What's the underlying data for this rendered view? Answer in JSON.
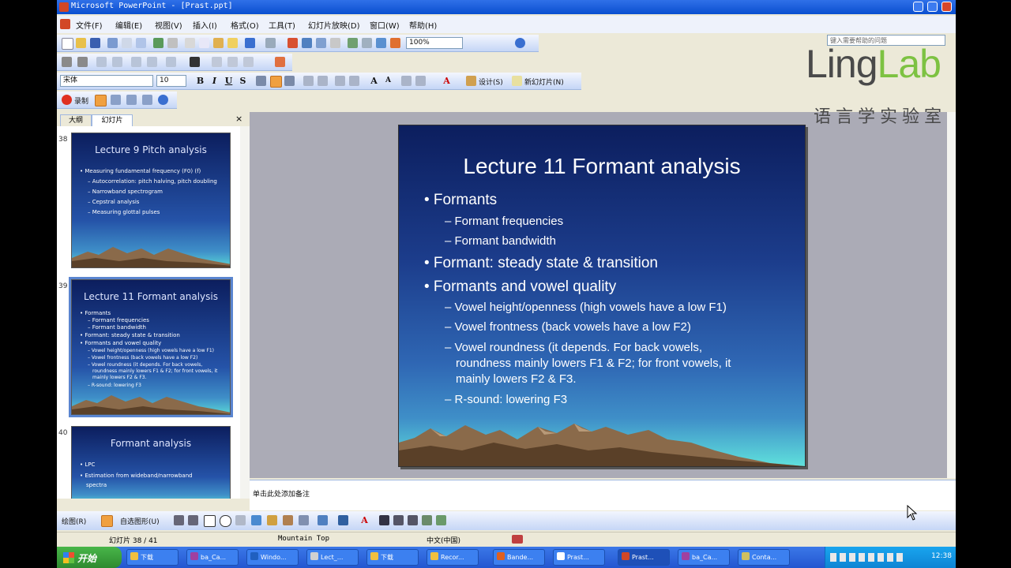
{
  "window": {
    "title": "Microsoft PowerPoint - [Prast.ppt]",
    "help_placeholder": "键入需要帮助的问题"
  },
  "menu": [
    "文件(F)",
    "编辑(E)",
    "视图(V)",
    "插入(I)",
    "格式(O)",
    "工具(T)",
    "幻灯片放映(D)",
    "窗口(W)",
    "帮助(H)"
  ],
  "toolbar": {
    "zoom": "100%",
    "font_name": "宋体",
    "font_size": "10",
    "bold": "B",
    "italic": "I",
    "underline": "U",
    "shadow": "S",
    "design_label": "设计(S)",
    "new_slide_label": "新幻灯片(N)",
    "record_label": "录制"
  },
  "pane_tabs": {
    "outline": "大纲",
    "slides": "幻灯片"
  },
  "thumbnails": [
    {
      "num": "38",
      "title": "Lecture 9 Pitch analysis",
      "lines": [
        "• Measuring fundamental frequency (F0) (f)",
        "– Autocorrelation: pitch halving, pitch doubling",
        "– Narrowband spectrogram",
        "– Cepstral analysis",
        "– Measuring glottal pulses"
      ]
    },
    {
      "num": "39",
      "title": "Lecture 11 Formant analysis",
      "lines": [
        "• Formants",
        "– Formant frequencies",
        "– Formant bandwidth",
        "• Formant: steady state & transition",
        "• Formants and vowel quality",
        "– Vowel height/openness (high vowels have a low F1)",
        "– Vowel frontness (back vowels have a low F2)",
        "– Vowel roundness (it depends. For back vowels,",
        "roundness mainly lowers F1 & F2; for front vowels, it",
        "mainly lowers F2 & F3.",
        "– R-sound: lowering F3"
      ]
    },
    {
      "num": "40",
      "title": "Formant analysis",
      "lines": [
        "• LPC",
        "• Estimation from wideband/narrowband",
        "spectra"
      ]
    }
  ],
  "slide": {
    "title": "Lecture 11 Formant analysis",
    "bullets": [
      "• Formants",
      "– Formant frequencies",
      "– Formant bandwidth",
      "• Formant: steady state & transition",
      "• Formants and vowel quality",
      "– Vowel height/openness (high vowels have a low F1)",
      "– Vowel frontness (back vowels have a low F2)",
      "– Vowel roundness (it depends. For back vowels,",
      "roundness mainly lowers F1 & F2; for front vowels, it",
      "mainly lowers F2 & F3.",
      "– R-sound: lowering F3"
    ]
  },
  "notes_placeholder": "单击此处添加备注",
  "drawing": {
    "draw_label": "绘图(R)",
    "autoshapes_label": "自选图形(U)"
  },
  "status": {
    "slide_counter": "幻灯片 38 / 41",
    "template": "Mountain Top",
    "language": "中文(中国)"
  },
  "taskbar": {
    "start": "开始",
    "tasks": [
      "下载",
      "ba_Ca...",
      "Windo...",
      "Lect_...",
      "下载",
      "Recor...",
      "Bande...",
      "Prast...",
      "Prast...",
      "ba_Ca...",
      "Conta..."
    ],
    "clock": "12:38"
  },
  "logo": {
    "ling": "Ling",
    "lab": "Lab",
    "subtitle": "语言学实验室"
  },
  "colors": {
    "title_blue": "#0a4fd0",
    "slide_dark": "#0c1e5e",
    "logo_green": "#7dc242",
    "stage_gray": "#ABABB6"
  }
}
